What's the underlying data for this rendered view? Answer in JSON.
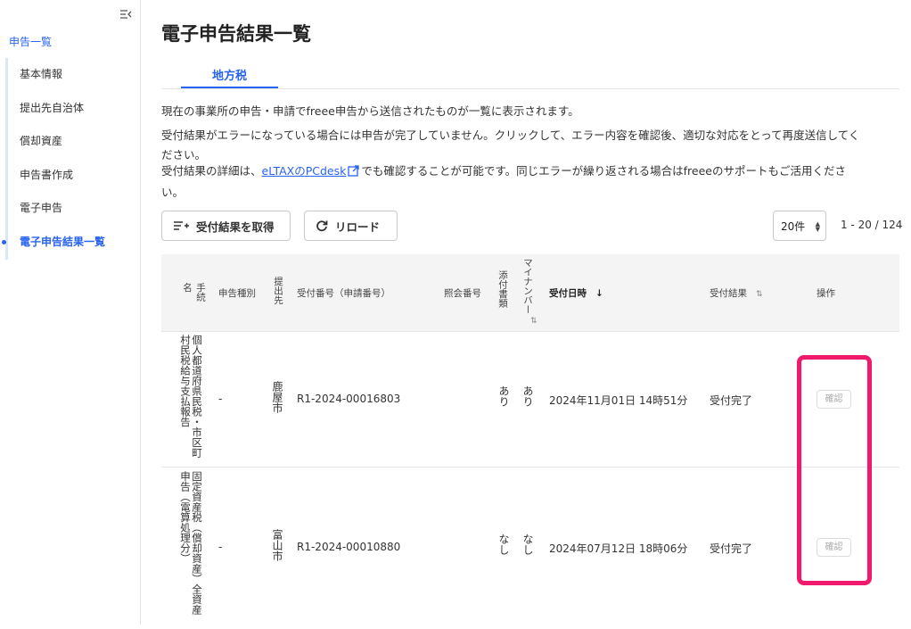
{
  "sidebar": {
    "top_link": "申告一覧",
    "items": [
      {
        "label": "基本情報"
      },
      {
        "label": "提出先自治体"
      },
      {
        "label": "償却資産"
      },
      {
        "label": "申告書作成"
      },
      {
        "label": "電子申告"
      },
      {
        "label": "電子申告結果一覧"
      }
    ],
    "active_index": 5
  },
  "page": {
    "title": "電子申告結果一覧",
    "tab": "地方税",
    "desc1": "現在の事業所の申告・申請でfreee申告から送信されたものが一覧に表示されます。",
    "desc2a": "受付結果がエラーになっている場合には申告が完了していません。クリックして、エラー内容を確認後、適切な対応をとって再度送信してく",
    "desc2b": "ださい。",
    "desc3a_pre": "受付結果の詳細は、",
    "desc3a_link": "eLTAXのPCdesk",
    "desc3a_post": "でも確認することが可能です。同じエラーが繰り返される場合はfreeeのサポートもご活用くださ",
    "desc3b": "い。"
  },
  "toolbar": {
    "fetch_label": "受付結果を取得",
    "reload_label": "リロード",
    "per_page": "20件",
    "range": "1 - 20 / 124"
  },
  "table": {
    "headers": {
      "procedure": "手続名",
      "type": "申告種別",
      "dest": "提出先",
      "receipt_no": "受付番号（申請番号）",
      "ref_no": "照会番号",
      "attach": "添付書類",
      "mynumber": "マイナンバー",
      "received_at": "受付日時",
      "result": "受付結果",
      "action": "操作"
    },
    "rows": [
      {
        "procedure": "個人都道府県民税・市区町村民税給与支払報告",
        "type": "-",
        "dest": "鹿屋市",
        "receipt_no": "R1-2024-00016803",
        "ref_no": "",
        "attach": "あり",
        "mynumber": "あり",
        "received_at": "2024年11月01日 14時51分",
        "result": "受付完了",
        "action": "確認"
      },
      {
        "procedure": "固定資産税（償却資産）全資産申告（電算処理分）",
        "type": "-",
        "dest": "富山市",
        "receipt_no": "R1-2024-00010880",
        "ref_no": "",
        "attach": "なし",
        "mynumber": "なし",
        "received_at": "2024年07月12日 18時06分",
        "result": "受付完了",
        "action": "確認"
      }
    ]
  },
  "colors": {
    "accent": "#2864f0",
    "highlight": "#f0196c"
  }
}
